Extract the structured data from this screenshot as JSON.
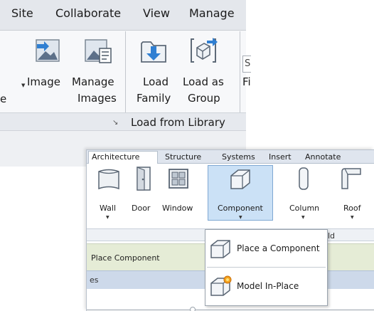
{
  "top_ribbon": {
    "tabs": [
      {
        "label": "Site"
      },
      {
        "label": "Collaborate"
      },
      {
        "label": "View"
      },
      {
        "label": "Manage"
      }
    ],
    "cut_label": "e",
    "buttons": {
      "image": {
        "label": "Image",
        "icon": "image-icon"
      },
      "manage_images": {
        "line1": "Manage",
        "line2": "Images",
        "icon": "manage-images-icon"
      },
      "load_family": {
        "line1": "Load",
        "line2": "Family",
        "icon": "load-family-icon"
      },
      "load_as_group": {
        "line1": "Load as",
        "line2": "Group",
        "icon": "load-as-group-icon"
      }
    },
    "cut_right_top": "S",
    "cut_right_bottom": "Fi",
    "panel_footer": {
      "load_from_library": "Load from Library",
      "launcher": "↘"
    }
  },
  "bottom_ribbon": {
    "tabs": [
      {
        "label": "Architecture",
        "active": true
      },
      {
        "label": "Structure"
      },
      {
        "label": "Systems"
      },
      {
        "label": "Insert"
      },
      {
        "label": "Annotate"
      }
    ],
    "buttons": [
      {
        "label": "Wall",
        "icon": "wall-icon",
        "has_dropdown": true
      },
      {
        "label": "Door",
        "icon": "door-icon"
      },
      {
        "label": "Window",
        "icon": "window-icon"
      },
      {
        "label": "Component",
        "icon": "component-icon",
        "has_dropdown": true,
        "active": true
      },
      {
        "label": "Column",
        "icon": "column-icon",
        "has_dropdown": true
      },
      {
        "label": "Roof",
        "icon": "roof-icon",
        "has_dropdown": true
      }
    ],
    "dropdown": {
      "items": [
        {
          "label": "Place a Component",
          "icon": "place-component-icon"
        },
        {
          "label": "Model In-Place",
          "icon": "model-in-place-icon"
        }
      ],
      "peek_text": "ld"
    },
    "status": {
      "text": "Place Component"
    },
    "properties_strip": {
      "text": "es"
    }
  },
  "colors": {
    "active_highlight": "#cbe1f6",
    "status_bar": "#e5ecd6",
    "icon_blue": "#2f7fd2"
  }
}
